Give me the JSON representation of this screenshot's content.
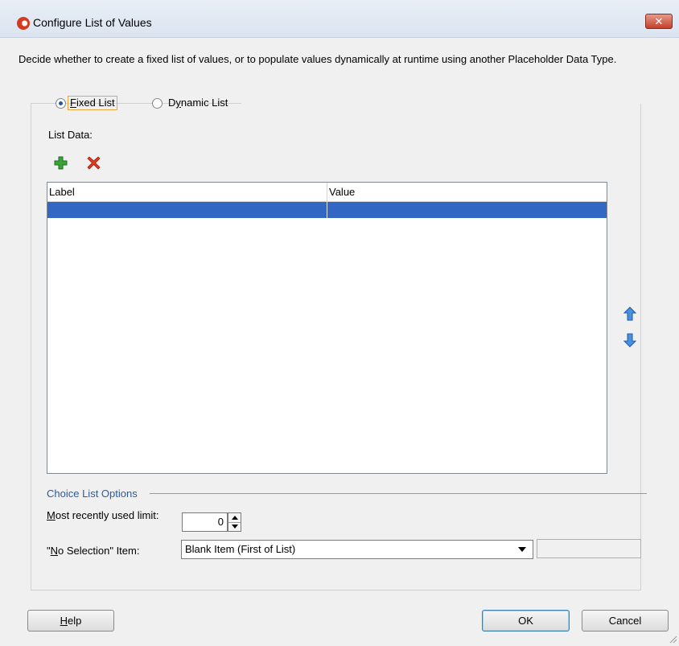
{
  "window": {
    "title": "Configure List of Values",
    "close_label": "✕"
  },
  "description": "Decide whether to create a fixed list of values, or to populate values dynamically at runtime using another Placeholder Data Type.",
  "mode": {
    "fixed_label_first": "F",
    "fixed_label_rest": "ixed List",
    "dynamic_label_first": "D",
    "dynamic_label_mid": "y",
    "dynamic_label_rest": "namic List",
    "selected": "fixed"
  },
  "list_data": {
    "label": "List Data:",
    "columns": [
      "Label",
      "Value"
    ],
    "selection_color": "#3268c3"
  },
  "choice_options": {
    "title": "Choice List Options",
    "mru_label_first": "M",
    "mru_label_rest": "ost recently used limit:",
    "mru_value": "0",
    "nosel_label_prefix": "\"",
    "nosel_label_mnemonic": "N",
    "nosel_label_rest": "o Selection\" Item:",
    "nosel_value": "Blank Item (First of List)"
  },
  "buttons": {
    "help_first": "H",
    "help_rest": "elp",
    "ok": "OK",
    "cancel": "Cancel"
  },
  "icons": {
    "add": "add-icon",
    "remove": "remove-icon",
    "move_up": "arrow-up-icon",
    "move_down": "arrow-down-icon",
    "app_logo": "oracle-logo-icon"
  }
}
